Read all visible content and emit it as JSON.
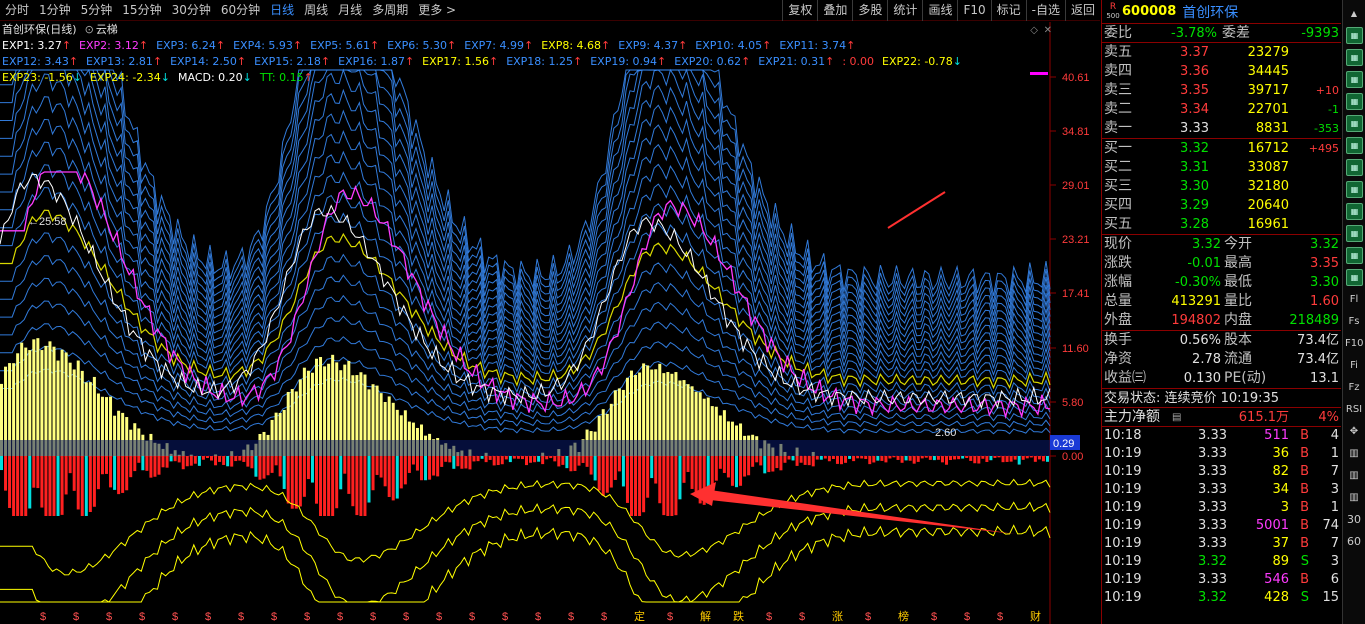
{
  "periods": [
    "分时",
    "1分钟",
    "5分钟",
    "15分钟",
    "30分钟",
    "60分钟",
    "日线",
    "周线",
    "月线",
    "多周期",
    "更多 >"
  ],
  "active_period": "日线",
  "tools": [
    "复权",
    "叠加",
    "多股",
    "统计",
    "画线",
    "F10",
    "标记",
    "-自选",
    "返回"
  ],
  "chart": {
    "title": "首创环保(日线)",
    "indicator": "云梯",
    "rows": [
      [
        {
          "t": "EXP1: 3.27",
          "c": "#ffffff",
          "a": "up"
        },
        {
          "t": "EXP2: 3.12",
          "c": "#ff3bff",
          "a": "up"
        },
        {
          "t": "EXP3: 6.24",
          "c": "#3a8fff",
          "a": "up"
        },
        {
          "t": "EXP4: 5.93",
          "c": "#3a8fff",
          "a": "up"
        },
        {
          "t": "EXP5: 5.61",
          "c": "#3a8fff",
          "a": "up"
        },
        {
          "t": "EXP6: 5.30",
          "c": "#3a8fff",
          "a": "up"
        },
        {
          "t": "EXP7: 4.99",
          "c": "#3a8fff",
          "a": "up"
        },
        {
          "t": "EXP8: 4.68",
          "c": "#ffff00",
          "a": "up"
        },
        {
          "t": "EXP9: 4.37",
          "c": "#3a8fff",
          "a": "up"
        },
        {
          "t": "EXP10: 4.05",
          "c": "#3a8fff",
          "a": "up"
        },
        {
          "t": "EXP11: 3.74",
          "c": "#3a8fff",
          "a": "up"
        }
      ],
      [
        {
          "t": "EXP12: 3.43",
          "c": "#3a8fff",
          "a": "up"
        },
        {
          "t": "EXP13: 2.81",
          "c": "#3a8fff",
          "a": "up"
        },
        {
          "t": "EXP14: 2.50",
          "c": "#3a8fff",
          "a": "up"
        },
        {
          "t": "EXP15: 2.18",
          "c": "#3a8fff",
          "a": "up"
        },
        {
          "t": "EXP16: 1.87",
          "c": "#3a8fff",
          "a": "up"
        },
        {
          "t": "EXP17: 1.56",
          "c": "#ffff00",
          "a": "up"
        },
        {
          "t": "EXP18: 1.25",
          "c": "#3a8fff",
          "a": "up"
        },
        {
          "t": "EXP19: 0.94",
          "c": "#3a8fff",
          "a": "up"
        },
        {
          "t": "EXP20: 0.62",
          "c": "#3a8fff",
          "a": "up"
        },
        {
          "t": "EXP21: 0.31",
          "c": "#3a8fff",
          "a": "up"
        },
        {
          "t": ": 0.00",
          "c": "#ff3b3b",
          "a": ""
        },
        {
          "t": "EXP22: -0.78",
          "c": "#ffff00",
          "a": "down"
        }
      ],
      [
        {
          "t": "EXP23: -1.56",
          "c": "#ffff00",
          "a": "down"
        },
        {
          "t": "EXP24: -2.34",
          "c": "#ffff00",
          "a": "down"
        },
        {
          "t": "MACD: 0.20",
          "c": "#ffffff",
          "a": "down"
        },
        {
          "t": "TT: 0.15",
          "c": "#00e000",
          "a": "up"
        }
      ]
    ],
    "y_ticks": [
      "40.61",
      "34.81",
      "29.01",
      "23.21",
      "17.41",
      "11.60",
      "5.80",
      "0.00"
    ],
    "max_label": "25.58",
    "min_label": "2.60",
    "current_tag": "0.29",
    "bottom_marks": [
      "$",
      "$",
      "$",
      "$",
      "$",
      "$",
      "$",
      "$",
      "$",
      "$",
      "$",
      "$",
      "$",
      "$",
      "$",
      "$",
      "$",
      "$",
      "定",
      "$",
      "解",
      "跌",
      "$",
      "$",
      "涨",
      "$",
      "榜",
      "$",
      "$",
      "$",
      "财"
    ]
  },
  "quote": {
    "r_badge": "R",
    "r_sub": "500",
    "code": "600008",
    "name": "首创环保",
    "weibi_label": "委比",
    "weibi": "-3.78%",
    "weicha_label": "委差",
    "weicha": "-9393",
    "asks": [
      {
        "label": "卖五",
        "price": "3.37",
        "vol": "23279",
        "chg": ""
      },
      {
        "label": "卖四",
        "price": "3.36",
        "vol": "34445",
        "chg": ""
      },
      {
        "label": "卖三",
        "price": "3.35",
        "vol": "39717",
        "chg": "+10"
      },
      {
        "label": "卖二",
        "price": "3.34",
        "vol": "22701",
        "chg": "-1"
      },
      {
        "label": "卖一",
        "price": "3.33",
        "vol": "8831",
        "chg": "-353"
      }
    ],
    "bids": [
      {
        "label": "买一",
        "price": "3.32",
        "vol": "16712",
        "chg": "+495"
      },
      {
        "label": "买二",
        "price": "3.31",
        "vol": "33087",
        "chg": ""
      },
      {
        "label": "买三",
        "price": "3.30",
        "vol": "32180",
        "chg": ""
      },
      {
        "label": "买四",
        "price": "3.29",
        "vol": "20640",
        "chg": ""
      },
      {
        "label": "买五",
        "price": "3.28",
        "vol": "16961",
        "chg": ""
      }
    ],
    "stats1": [
      {
        "l1": "现价",
        "v1": "3.32",
        "c1": "grn",
        "l2": "今开",
        "v2": "3.32",
        "c2": "grn"
      },
      {
        "l1": "涨跌",
        "v1": "-0.01",
        "c1": "grn",
        "l2": "最高",
        "v2": "3.35",
        "c2": "red"
      },
      {
        "l1": "涨幅",
        "v1": "-0.30%",
        "c1": "grn",
        "l2": "最低",
        "v2": "3.30",
        "c2": "grn"
      },
      {
        "l1": "总量",
        "v1": "413291",
        "c1": "yel",
        "l2": "量比",
        "v2": "1.60",
        "c2": "red"
      },
      {
        "l1": "外盘",
        "v1": "194802",
        "c1": "red",
        "l2": "内盘",
        "v2": "218489",
        "c2": "grn"
      }
    ],
    "stats2": [
      {
        "l1": "换手",
        "v1": "0.56%",
        "c1": "wht",
        "l2": "股本",
        "v2": "73.4亿",
        "c2": "wht"
      },
      {
        "l1": "净资",
        "v1": "2.78",
        "c1": "wht",
        "l2": "流通",
        "v2": "73.4亿",
        "c2": "wht"
      },
      {
        "l1": "收益㈢",
        "v1": "0.130",
        "c1": "wht",
        "l2": "PE(动)",
        "v2": "13.1",
        "c2": "wht"
      }
    ],
    "trade_status": "交易状态: 连续竞价 10:19:35",
    "main_label": "主力净额",
    "main_value": "615.1万",
    "main_pct": "4%",
    "ticks": [
      {
        "t": "10:18",
        "p": "3.33",
        "v": "511",
        "s": "B",
        "n": "4",
        "pc": "wht",
        "vc": "mag"
      },
      {
        "t": "10:19",
        "p": "3.33",
        "v": "36",
        "s": "B",
        "n": "1",
        "pc": "wht",
        "vc": "yel"
      },
      {
        "t": "10:19",
        "p": "3.33",
        "v": "82",
        "s": "B",
        "n": "7",
        "pc": "wht",
        "vc": "yel"
      },
      {
        "t": "10:19",
        "p": "3.33",
        "v": "34",
        "s": "B",
        "n": "3",
        "pc": "wht",
        "vc": "yel"
      },
      {
        "t": "10:19",
        "p": "3.33",
        "v": "3",
        "s": "B",
        "n": "1",
        "pc": "wht",
        "vc": "yel"
      },
      {
        "t": "10:19",
        "p": "3.33",
        "v": "5001",
        "s": "B",
        "n": "74",
        "pc": "wht",
        "vc": "mag"
      },
      {
        "t": "10:19",
        "p": "3.33",
        "v": "37",
        "s": "B",
        "n": "7",
        "pc": "wht",
        "vc": "yel"
      },
      {
        "t": "10:19",
        "p": "3.32",
        "v": "89",
        "s": "S",
        "n": "3",
        "pc": "grn",
        "vc": "yel"
      },
      {
        "t": "10:19",
        "p": "3.33",
        "v": "546",
        "s": "B",
        "n": "6",
        "pc": "wht",
        "vc": "mag"
      },
      {
        "t": "10:19",
        "p": "3.32",
        "v": "428",
        "s": "S",
        "n": "15",
        "pc": "grn",
        "vc": "yel"
      }
    ]
  },
  "side_icons": [
    "Fl",
    "Fs",
    "F10",
    "Fi",
    "Fz",
    "RSI"
  ],
  "side_nums": [
    "30",
    "60"
  ]
}
